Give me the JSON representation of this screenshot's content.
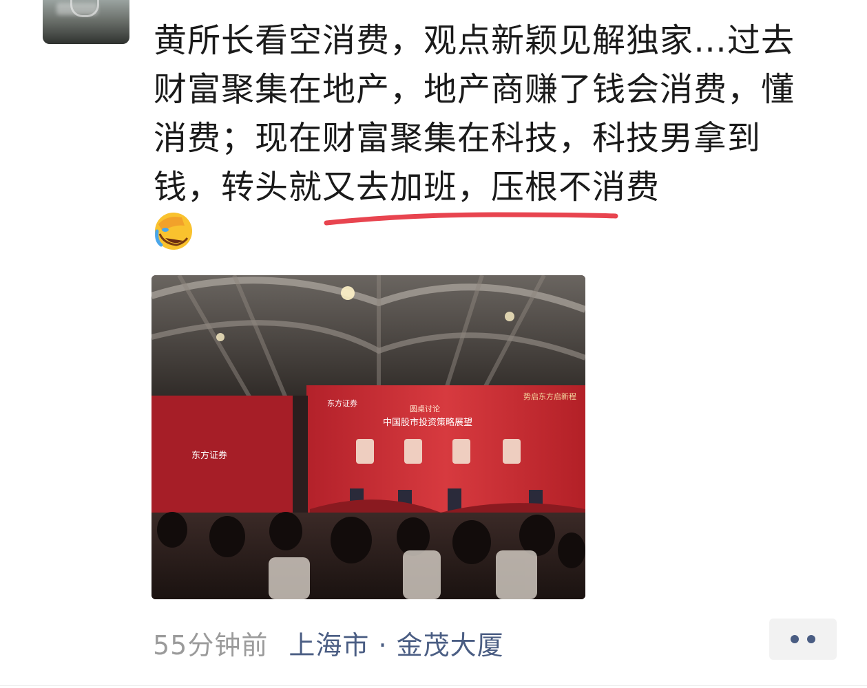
{
  "post": {
    "text": "黄所长看空消费，观点新颖见解独家…过去财富聚集在地产，地产商赚了钱会消费，懂消费；现在财富聚集在科技，科技男拿到钱，转头就又去加班，压根不消费",
    "emoji": "facepalm-laughing-emoji"
  },
  "photo": {
    "logo_main": "东方证券",
    "logo_side": "东方证券",
    "slogan": "势启东方启新程",
    "panel_title": "圆桌讨论",
    "panel_subtitle": "中国股市投资策略展望"
  },
  "meta": {
    "time": "55分钟前",
    "location": "上海市 · 金茂大厦"
  },
  "colors": {
    "text": "#1a1a1a",
    "time": "#9b9b9b",
    "link": "#4a5d83",
    "underline": "#e8444f"
  }
}
